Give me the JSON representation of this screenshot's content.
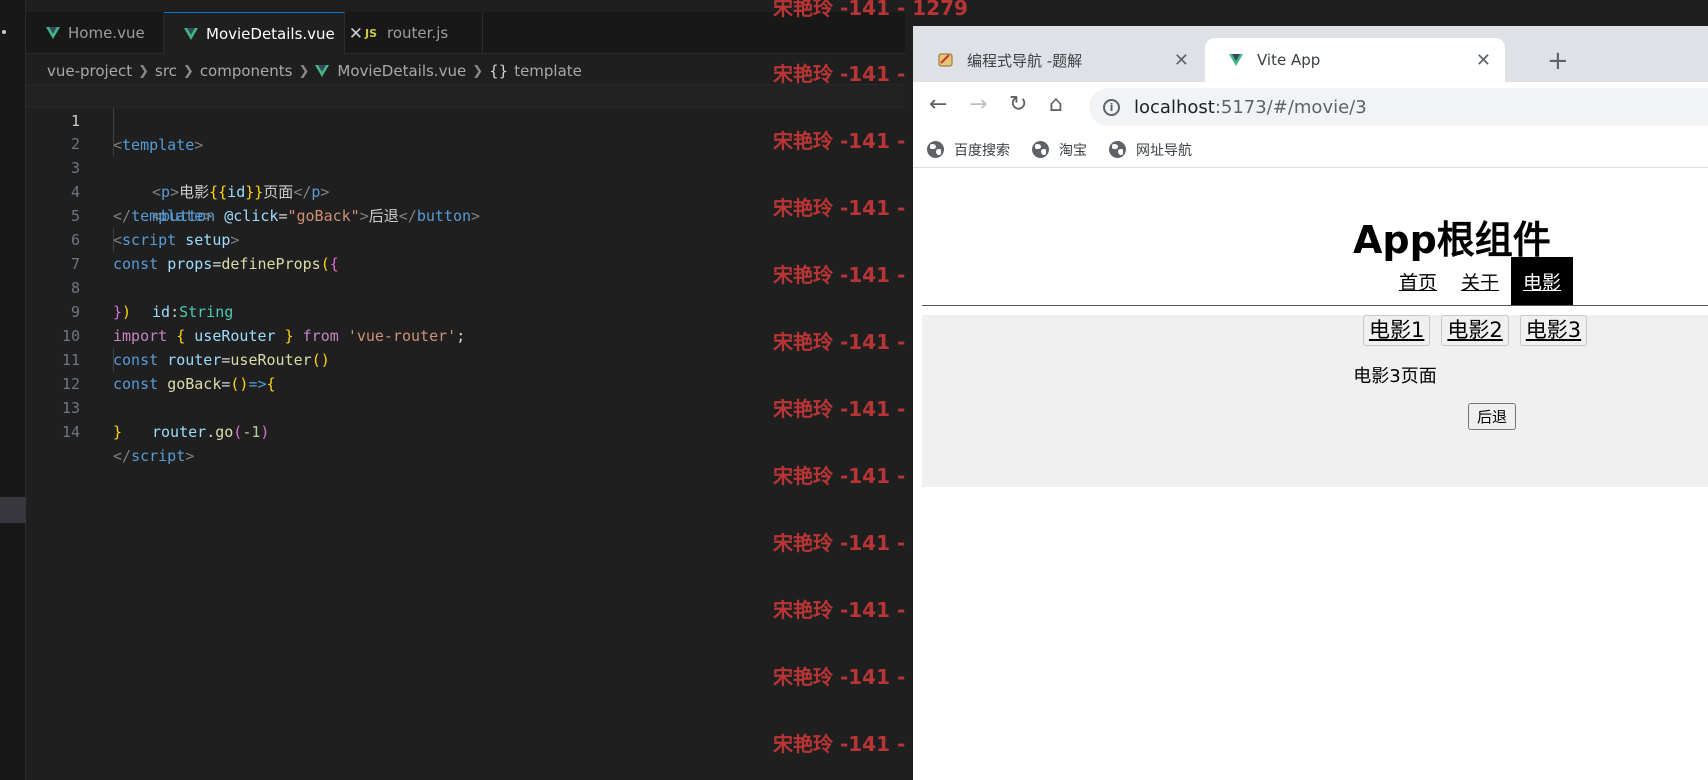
{
  "editor": {
    "tabs": [
      {
        "label": "Home.vue",
        "icon": "vue-icon"
      },
      {
        "label": "MovieDetails.vue",
        "icon": "vue-icon",
        "active": true
      },
      {
        "label": "router.js",
        "icon": "js-icon",
        "badge": "JS"
      }
    ],
    "breadcrumb": [
      "vue-project",
      "src",
      "components",
      "MovieDetails.vue",
      "template"
    ],
    "breadcrumb_braces": "{}",
    "line_numbers": [
      "1",
      "2",
      "3",
      "4",
      "5",
      "6",
      "7",
      "8",
      "9",
      "10",
      "11",
      "12",
      "13",
      "14"
    ],
    "code": {
      "l1": [
        "<",
        "template",
        ">"
      ],
      "l2": [
        "<",
        "p",
        ">",
        "电影",
        "{{",
        "id",
        "}}",
        "页面",
        "</",
        "p",
        ">"
      ],
      "l3": [
        "<",
        "button",
        " ",
        "@click",
        "=",
        "\"goBack\"",
        ">",
        "后退",
        "</",
        "button",
        ">"
      ],
      "l4": [
        "</",
        "template",
        ">"
      ],
      "l5": [
        "<",
        "script",
        " ",
        "setup",
        ">"
      ],
      "l6": [
        "const",
        " ",
        "props",
        "=",
        "defineProps",
        "(",
        "{"
      ],
      "l7": [
        "id",
        ":",
        "String"
      ],
      "l8": [
        "}",
        ")"
      ],
      "l9": [
        "import",
        " ",
        "{",
        " ",
        "useRouter",
        " ",
        "}",
        " ",
        "from",
        " ",
        "'vue-router'",
        ";"
      ],
      "l10": [
        "const",
        " ",
        "router",
        "=",
        "useRouter",
        "()"
      ],
      "l11": [
        "const",
        " ",
        "goBack",
        "=",
        "()",
        "=>",
        "{"
      ],
      "l12": [
        "router",
        ".",
        "go",
        "(",
        "-1",
        ")"
      ],
      "l13": [
        "}"
      ],
      "l14": [
        "</",
        "script",
        ">"
      ]
    },
    "watermark": "宋艳玲 -141 - 1279"
  },
  "browser": {
    "tabs": [
      {
        "label": "编程式导航 -题解",
        "icon": "page-icon"
      },
      {
        "label": "Vite App",
        "icon": "vue-icon",
        "active": true
      }
    ],
    "new_tab": "+",
    "url_host": "localhost",
    "url_rest": ":5173/#/movie/3",
    "bookmarks": [
      "百度搜索",
      "淘宝",
      "网址导航"
    ],
    "page": {
      "title": "App根组件",
      "nav": [
        "首页",
        "关于",
        "电影"
      ],
      "active_nav": "电影",
      "movie_links": [
        "电影1",
        "电影2",
        "电影3"
      ],
      "movie_text": "电影3页面",
      "back_button": "后退"
    }
  }
}
